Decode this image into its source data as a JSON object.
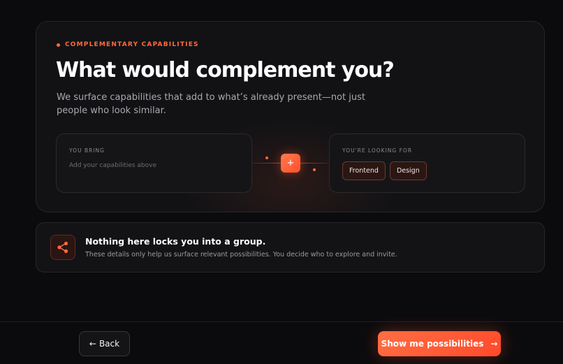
{
  "hero": {
    "eyebrow": "COMPLEMENTARY CAPABILITIES",
    "title": "What would complement you?",
    "subtitle": "We surface capabilities that add to what’s already present—not just people who look similar."
  },
  "you_bring": {
    "label": "YOU BRING",
    "placeholder": "Add your capabilities above"
  },
  "connector": {
    "plus_label": "+"
  },
  "looking_for": {
    "label": "YOU'RE LOOKING FOR",
    "tags": [
      "Frontend",
      "Design"
    ]
  },
  "info": {
    "icon": "share-icon",
    "title": "Nothing here locks you into a group.",
    "text": "These details only help us surface relevant possibilities. You decide who to explore and invite."
  },
  "footer": {
    "back_arrow": "←",
    "back_label": "Back",
    "primary_label": "Show me possibilities",
    "primary_arrow": "→"
  },
  "colors": {
    "accent": "#ff6a3d",
    "background": "#0b0b0d",
    "card": "#121215"
  }
}
